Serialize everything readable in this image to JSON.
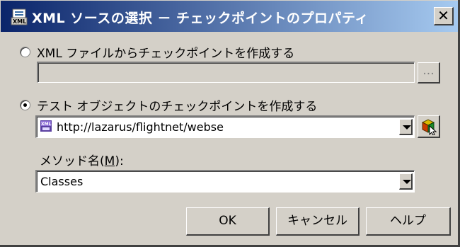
{
  "window": {
    "title": "XML ソースの選択 － チェックポイントのプロパティ",
    "close_label": "✕",
    "icon": "xml-document-icon"
  },
  "option_file": {
    "label": "XML ファイルからチェックポイントを作成する",
    "selected": false,
    "path_value": "",
    "browse_label": "..."
  },
  "option_object": {
    "label": "テスト オブジェクトのチェックポイントを作成する",
    "selected": true,
    "object_value": "http://lazarus/flightnet/webse",
    "object_icon": "xml-object-icon",
    "pointer_icon": "object-spy-pointer-icon"
  },
  "method": {
    "label_prefix": "メソッド名(",
    "label_accel": "M",
    "label_suffix": "):",
    "value": "Classes"
  },
  "buttons": {
    "ok": "OK",
    "cancel": "キャンセル",
    "help": "ヘルプ"
  },
  "colors": {
    "face": "#d4d0c8",
    "title_start": "#0a246a",
    "title_end": "#a6caf0"
  }
}
